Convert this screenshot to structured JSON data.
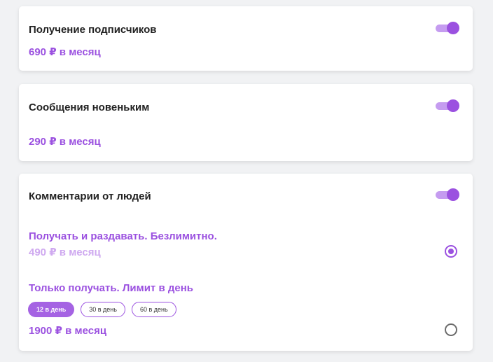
{
  "cards": [
    {
      "title": "Получение подписчиков",
      "price": "690 ₽ в месяц",
      "toggle_on": true
    },
    {
      "title": "Сообщения новеньким",
      "price": "290 ₽ в месяц",
      "toggle_on": true
    },
    {
      "title": "Комментарии от людей",
      "toggle_on": true,
      "options": [
        {
          "title": "Получать и раздавать. Безлимитно.",
          "price": "490 ₽ в месяц",
          "selected": true
        },
        {
          "title": "Только получать. Лимит в день",
          "price": "1900 ₽ в месяц",
          "selected": false,
          "chips": [
            "12 в день",
            "30 в день",
            "60 в день"
          ],
          "active_chip": "12 в день"
        }
      ]
    }
  ],
  "colors": {
    "accent": "#9b51e0",
    "accent_light": "#c59cf0",
    "price_faded": "#cfa9f0",
    "background": "#f1f2f4",
    "card": "#ffffff"
  },
  "icons": {
    "toggle": "toggle-switch-icon",
    "radio_checked": "radio-checked-icon",
    "radio_unchecked": "radio-unchecked-icon"
  }
}
